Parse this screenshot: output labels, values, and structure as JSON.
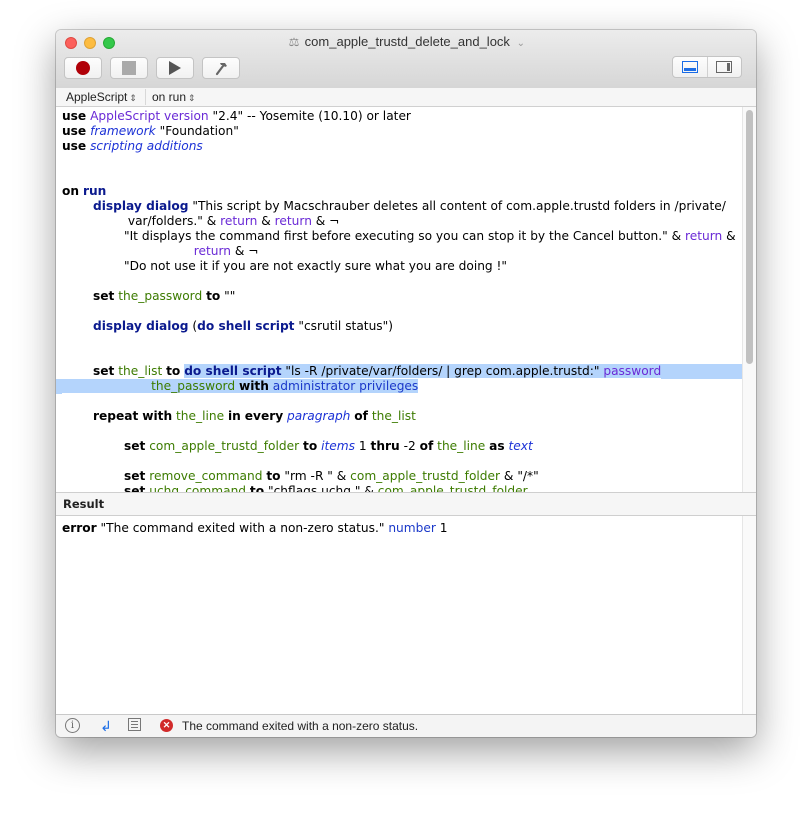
{
  "window": {
    "title": "com_apple_trustd_delete_and_lock",
    "title_icon": "script-document-icon",
    "title_chevron": "⌄"
  },
  "toolbar": {
    "record_label": "Record",
    "stop_label": "Stop",
    "run_label": "Run",
    "compile_label": "Compile",
    "view_buttons": [
      "show-bottom-pane",
      "show-side-pane"
    ],
    "view_selected": "show-bottom-pane",
    "accent_color": "#1a6ce6"
  },
  "navbar": {
    "language": "AppleScript",
    "handler": "on run"
  },
  "editor": {
    "lines": [
      [
        {
          "t": "use",
          "c": "kw"
        },
        {
          "t": " "
        },
        {
          "t": "AppleScript version",
          "c": "cls"
        },
        {
          "t": " \"2.4\" -- Yosemite (10.10) or later"
        }
      ],
      [
        {
          "t": "use",
          "c": "kw"
        },
        {
          "t": " "
        },
        {
          "t": "framework",
          "c": "prp"
        },
        {
          "t": " \"Foundation\""
        }
      ],
      [
        {
          "t": "use",
          "c": "kw"
        },
        {
          "t": " "
        },
        {
          "t": "scripting additions",
          "c": "prp"
        }
      ],
      [],
      [],
      [
        {
          "t": "on",
          "c": "kw"
        },
        {
          "t": " "
        },
        {
          "t": "run",
          "c": "blk"
        }
      ],
      [
        {
          "t": "        "
        },
        {
          "t": "display dialog",
          "c": "blk"
        },
        {
          "t": " \"This script by Macschrauber deletes all content of com.apple.trustd folders in /private/"
        }
      ],
      [
        {
          "t": "                 var/folders.\" & "
        },
        {
          "t": "return",
          "c": "enm"
        },
        {
          "t": " & "
        },
        {
          "t": "return",
          "c": "enm"
        },
        {
          "t": " & ¬"
        }
      ],
      [
        {
          "t": "                \"It displays the command first before executing so you can stop it by the Cancel button.\" & "
        },
        {
          "t": "return",
          "c": "enm"
        },
        {
          "t": " &"
        }
      ],
      [
        {
          "t": "                                  "
        },
        {
          "t": "return",
          "c": "enm"
        },
        {
          "t": " & ¬"
        }
      ],
      [
        {
          "t": "                \"Do not use it if you are not exactly sure what you are doing !\""
        }
      ],
      [],
      [
        {
          "t": "        "
        },
        {
          "t": "set",
          "c": "kw"
        },
        {
          "t": " "
        },
        {
          "t": "the_password",
          "c": "var"
        },
        {
          "t": " "
        },
        {
          "t": "to",
          "c": "kw"
        },
        {
          "t": " \"\""
        }
      ],
      [],
      [
        {
          "t": "        "
        },
        {
          "t": "display dialog",
          "c": "blk"
        },
        {
          "t": " ("
        },
        {
          "t": "do shell script",
          "c": "blk"
        },
        {
          "t": " \"csrutil status\")"
        }
      ],
      [],
      [],
      [
        {
          "t": "        "
        },
        {
          "t": "set",
          "c": "kw"
        },
        {
          "t": " "
        },
        {
          "t": "the_list",
          "c": "var"
        },
        {
          "t": " "
        },
        {
          "t": "to",
          "c": "kw"
        },
        {
          "t": " "
        },
        {
          "t": "do shell script",
          "c": "blk",
          "s": 1
        },
        {
          "t": " \"ls -R /private/var/folders/ | grep com.apple.trustd:\" ",
          "s": 1
        },
        {
          "t": "password",
          "c": "enm",
          "s": 1
        }
      ],
      [
        {
          "t": "                       ",
          "s": 1
        },
        {
          "t": "the_password",
          "c": "var",
          "s": 1
        },
        {
          "t": " ",
          "s": 1
        },
        {
          "t": "with",
          "c": "kw",
          "s": 1
        },
        {
          "t": " ",
          "s": 1
        },
        {
          "t": "administrator privileges",
          "c": "cmd",
          "s": 1
        }
      ],
      [],
      [
        {
          "t": "        "
        },
        {
          "t": "repeat",
          "c": "kw"
        },
        {
          "t": " "
        },
        {
          "t": "with",
          "c": "kw"
        },
        {
          "t": " "
        },
        {
          "t": "the_line",
          "c": "var"
        },
        {
          "t": " "
        },
        {
          "t": "in",
          "c": "kw"
        },
        {
          "t": " "
        },
        {
          "t": "every",
          "c": "kw"
        },
        {
          "t": " "
        },
        {
          "t": "paragraph",
          "c": "prp"
        },
        {
          "t": " "
        },
        {
          "t": "of",
          "c": "kw"
        },
        {
          "t": " "
        },
        {
          "t": "the_list",
          "c": "var"
        }
      ],
      [],
      [
        {
          "t": "                "
        },
        {
          "t": "set",
          "c": "kw"
        },
        {
          "t": " "
        },
        {
          "t": "com_apple_trustd_folder",
          "c": "var"
        },
        {
          "t": " "
        },
        {
          "t": "to",
          "c": "kw"
        },
        {
          "t": " "
        },
        {
          "t": "items",
          "c": "prp"
        },
        {
          "t": " 1 "
        },
        {
          "t": "thru",
          "c": "kw"
        },
        {
          "t": " -2 "
        },
        {
          "t": "of",
          "c": "kw"
        },
        {
          "t": " "
        },
        {
          "t": "the_line",
          "c": "var"
        },
        {
          "t": " "
        },
        {
          "t": "as",
          "c": "kw"
        },
        {
          "t": " "
        },
        {
          "t": "text",
          "c": "prp"
        }
      ],
      [],
      [
        {
          "t": "                "
        },
        {
          "t": "set",
          "c": "kw"
        },
        {
          "t": " "
        },
        {
          "t": "remove_command",
          "c": "var"
        },
        {
          "t": " "
        },
        {
          "t": "to",
          "c": "kw"
        },
        {
          "t": " \"rm -R \" & "
        },
        {
          "t": "com_apple_trustd_folder",
          "c": "var"
        },
        {
          "t": " & \"/*\""
        }
      ],
      [
        {
          "t": "                "
        },
        {
          "t": "set",
          "c": "kw"
        },
        {
          "t": " "
        },
        {
          "t": "uchg_command",
          "c": "var"
        },
        {
          "t": " "
        },
        {
          "t": "to",
          "c": "kw"
        },
        {
          "t": " \"chflags uchg \" & "
        },
        {
          "t": "com_apple_trustd_folder",
          "c": "var"
        }
      ]
    ]
  },
  "result": {
    "header": "Result",
    "keyword": "error",
    "message": " \"The command exited with a non-zero status.\" ",
    "number_label": "number",
    "number_value": " 1"
  },
  "statusbar": {
    "message": "The command exited with a non-zero status.",
    "error_color": "#d12a2a"
  }
}
